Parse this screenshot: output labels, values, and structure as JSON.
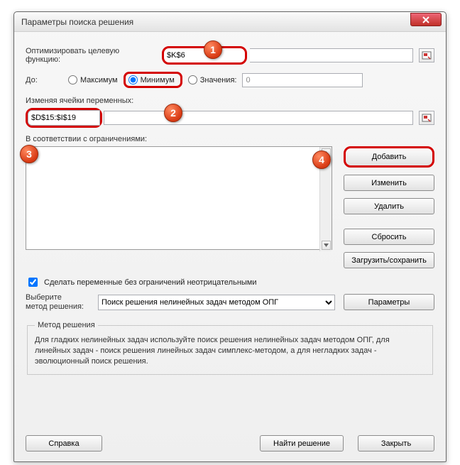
{
  "window": {
    "title": "Параметры поиска решения"
  },
  "objective": {
    "label": "Оптимизировать целевую функцию:",
    "value": "$K$6"
  },
  "to": {
    "label": "До:",
    "max": "Максимум",
    "min": "Минимум",
    "valLabel": "Значения:",
    "valValue": "0"
  },
  "changing": {
    "label": "Изменяя ячейки переменных:",
    "value": "$D$15:$I$19"
  },
  "constraints": {
    "label": "В соответствии с ограничениями:"
  },
  "buttons": {
    "add": "Добавить",
    "edit": "Изменить",
    "delete": "Удалить",
    "reset": "Сбросить",
    "loadsave": "Загрузить/сохранить",
    "params": "Параметры",
    "help": "Справка",
    "solve": "Найти решение",
    "close": "Закрыть"
  },
  "nonneg": {
    "label": "Сделать переменные без ограничений неотрицательными"
  },
  "method": {
    "chooseLabel": "Выберите\nметод решения:",
    "selected": "Поиск решения нелинейных задач методом ОПГ",
    "groupTitle": "Метод решения",
    "desc": "Для гладких нелинейных задач используйте поиск решения нелинейных задач методом ОПГ, для линейных задач - поиск решения линейных задач симплекс-методом, а для негладких задач - эволюционный поиск решения."
  },
  "callouts": {
    "c1": "1",
    "c2": "2",
    "c3": "3",
    "c4": "4"
  }
}
